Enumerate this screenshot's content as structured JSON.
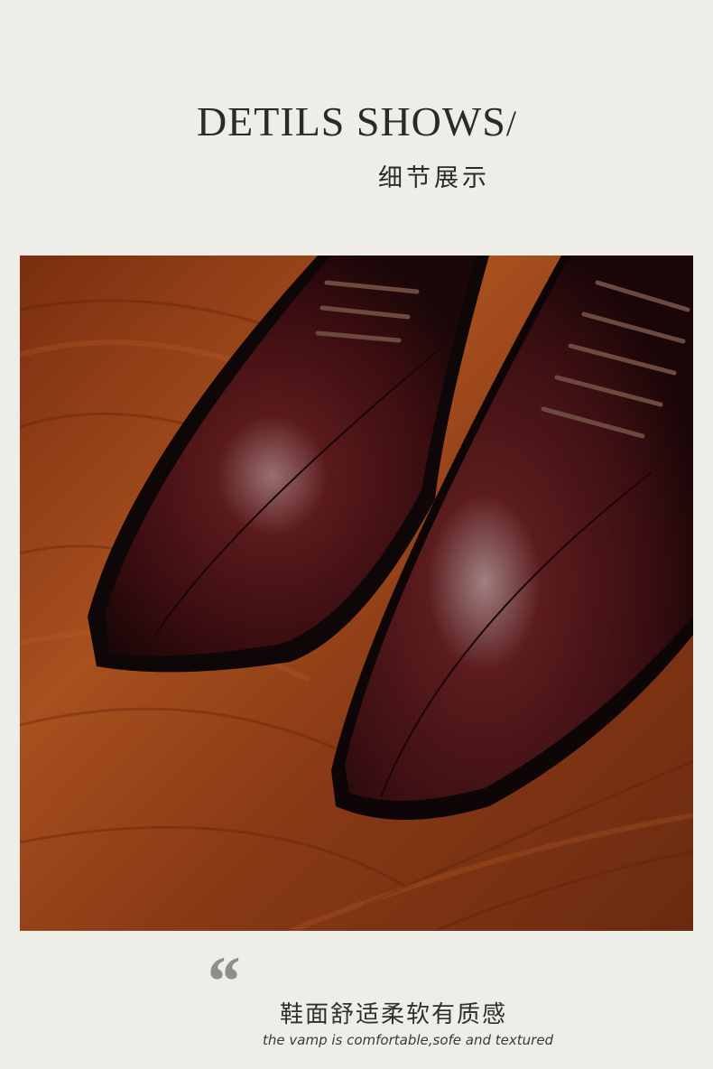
{
  "header": {
    "title_en": "DETILS SHOWS",
    "title_slash": "/",
    "title_cn": "细节展示"
  },
  "photo": {
    "subject": "shoe-photo",
    "colors": {
      "wood": "#8a3a15",
      "leather": "#3a0f10",
      "sole": "#111111"
    }
  },
  "caption": {
    "quote_mark": "“",
    "text_cn": "鞋面舒适柔软有质感",
    "text_en": "the vamp is comfortable,sofe and textured"
  }
}
